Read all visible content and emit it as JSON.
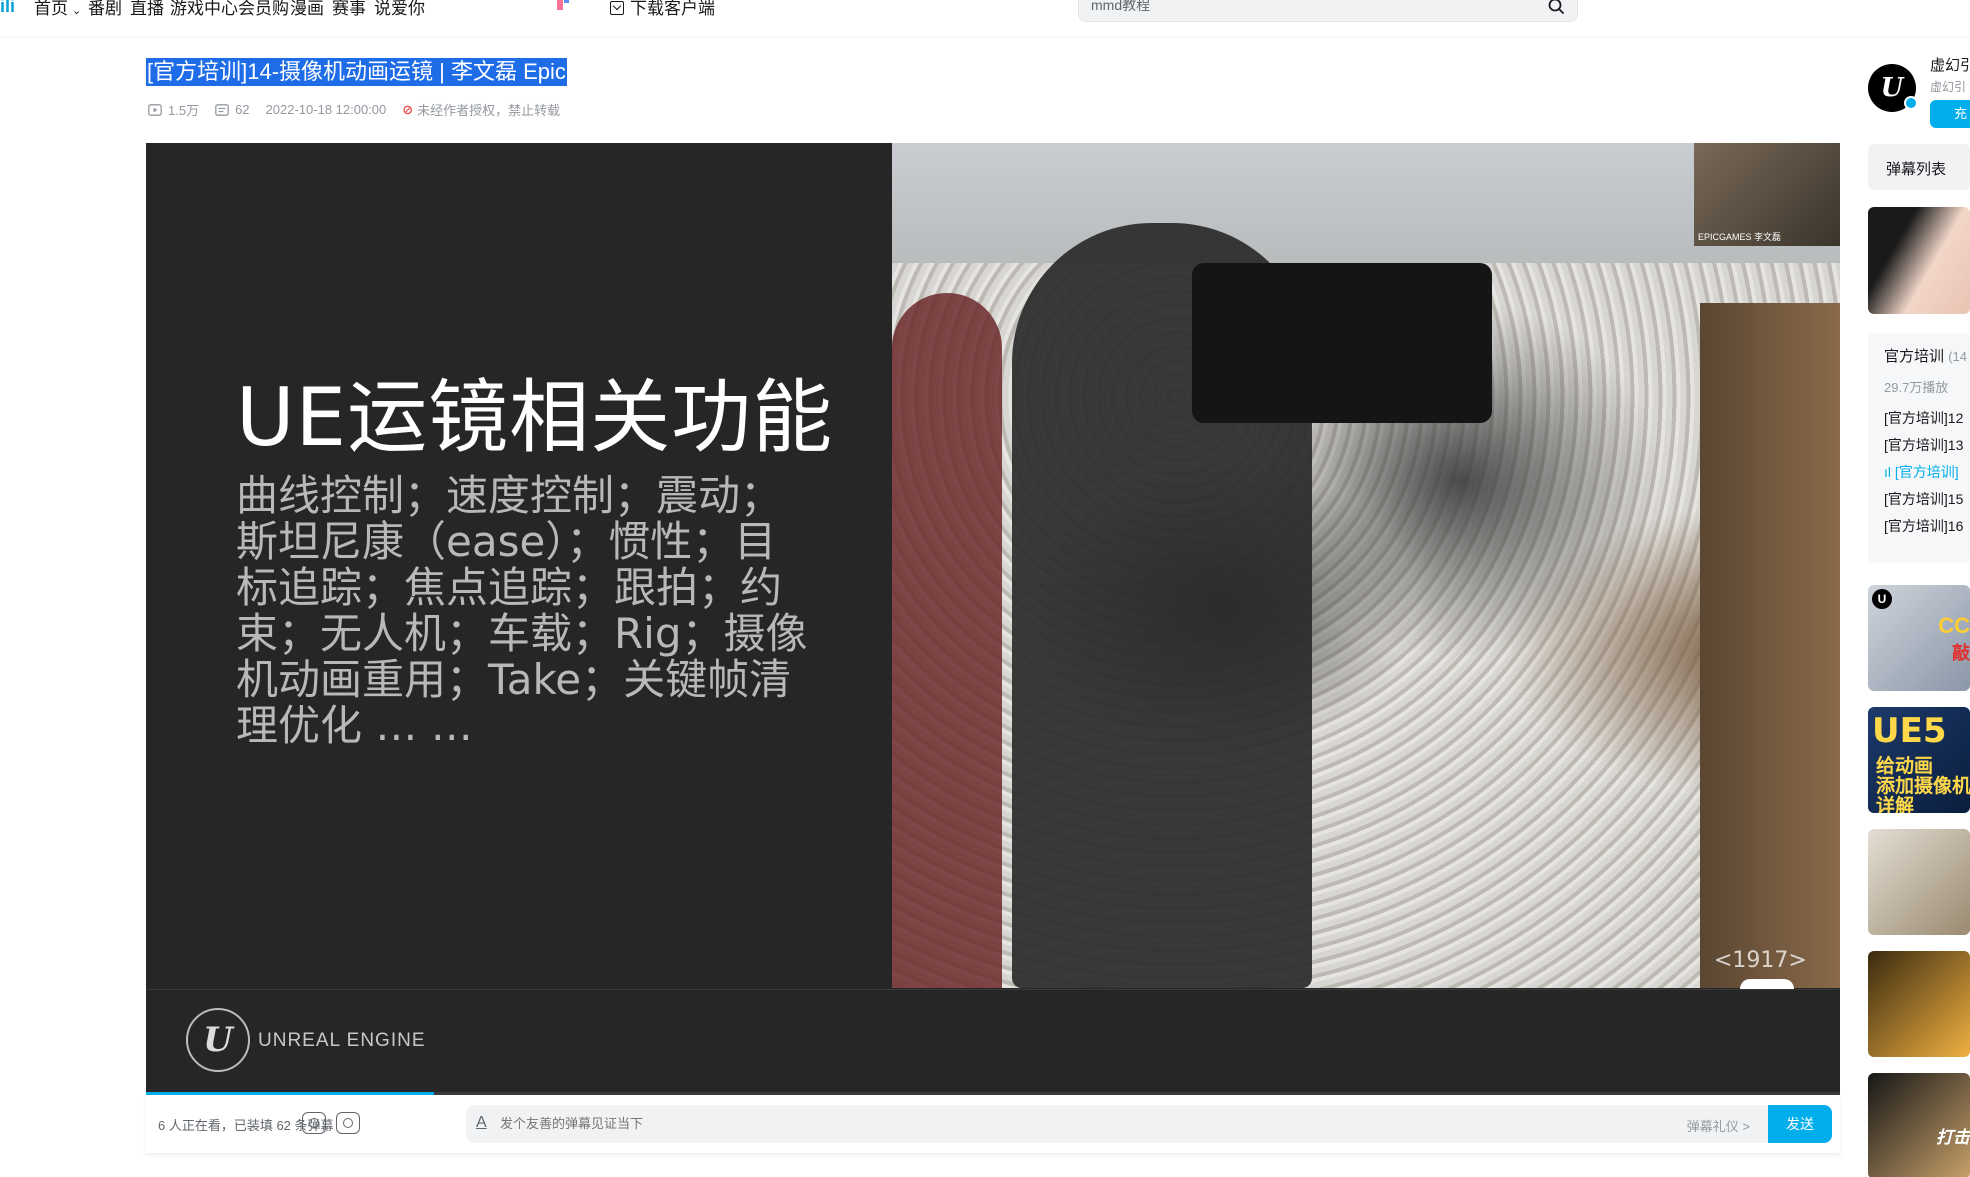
{
  "nav": {
    "logo": "ili",
    "items": [
      {
        "label": "首页",
        "has_chevron": true
      },
      {
        "label": "番剧"
      },
      {
        "label": "直播"
      },
      {
        "label": "游戏中心"
      },
      {
        "label": "会员购"
      },
      {
        "label": "漫画"
      },
      {
        "label": "赛事"
      },
      {
        "label": "说爱你"
      }
    ],
    "download_label": "下载客户端",
    "search_value": "mmd教程"
  },
  "video": {
    "title": "[官方培训]14-摄像机动画运镜 | 李文磊 Epic",
    "views": "1.5万",
    "danmaku_count": "62",
    "date": "2022-10-18 12:00:00",
    "copyright_note": "未经作者授权，禁止转载"
  },
  "slide": {
    "heading": "UE运镜相关功能",
    "body": "曲线控制；速度控制；震动；斯坦尼康（ease）；惯性；目标追踪；焦点追踪；跟拍；约束；无人机；车载；Rig；摄像机动画重用；Take；关键帧清理优化 … …",
    "pip_label": "EPICGAMES 李文磊",
    "watermark": "<1917>",
    "engine_logo": "U",
    "engine_text": "UNREAL ENGINE",
    "progress": 0.17
  },
  "danmaku": {
    "status": "6 人正在看，已装填 62 条弹幕",
    "placeholder": "发个友善的弹幕见证当下",
    "etiquette": "弹幕礼仪 >",
    "send": "发送"
  },
  "sidebar": {
    "up_name": "虚幻引",
    "up_desc": "虚幻引",
    "up_button": "充",
    "danmaku_list_tab": "弹幕列表",
    "playlist_title": "官方培训",
    "playlist_count": "(14",
    "playlist_views": "29.7万播放",
    "playlist_items": [
      {
        "label": "[官方培训]12",
        "active": false
      },
      {
        "label": "[官方培训]13",
        "active": false
      },
      {
        "label": "[官方培训]",
        "active": true
      },
      {
        "label": "[官方培训]15",
        "active": false
      },
      {
        "label": "[官方培训]16",
        "active": false
      }
    ],
    "rec1_corner_top": "CC",
    "rec1_corner_bottom": "敲",
    "rec2_title": "UE5",
    "rec2_sub": "给动画\n添加摄像机\n详解",
    "rec5_text": "打击"
  },
  "colors": {
    "accent": "#00aeec",
    "title_highlight": "#1e6ce8",
    "player_bg": "#262626"
  }
}
